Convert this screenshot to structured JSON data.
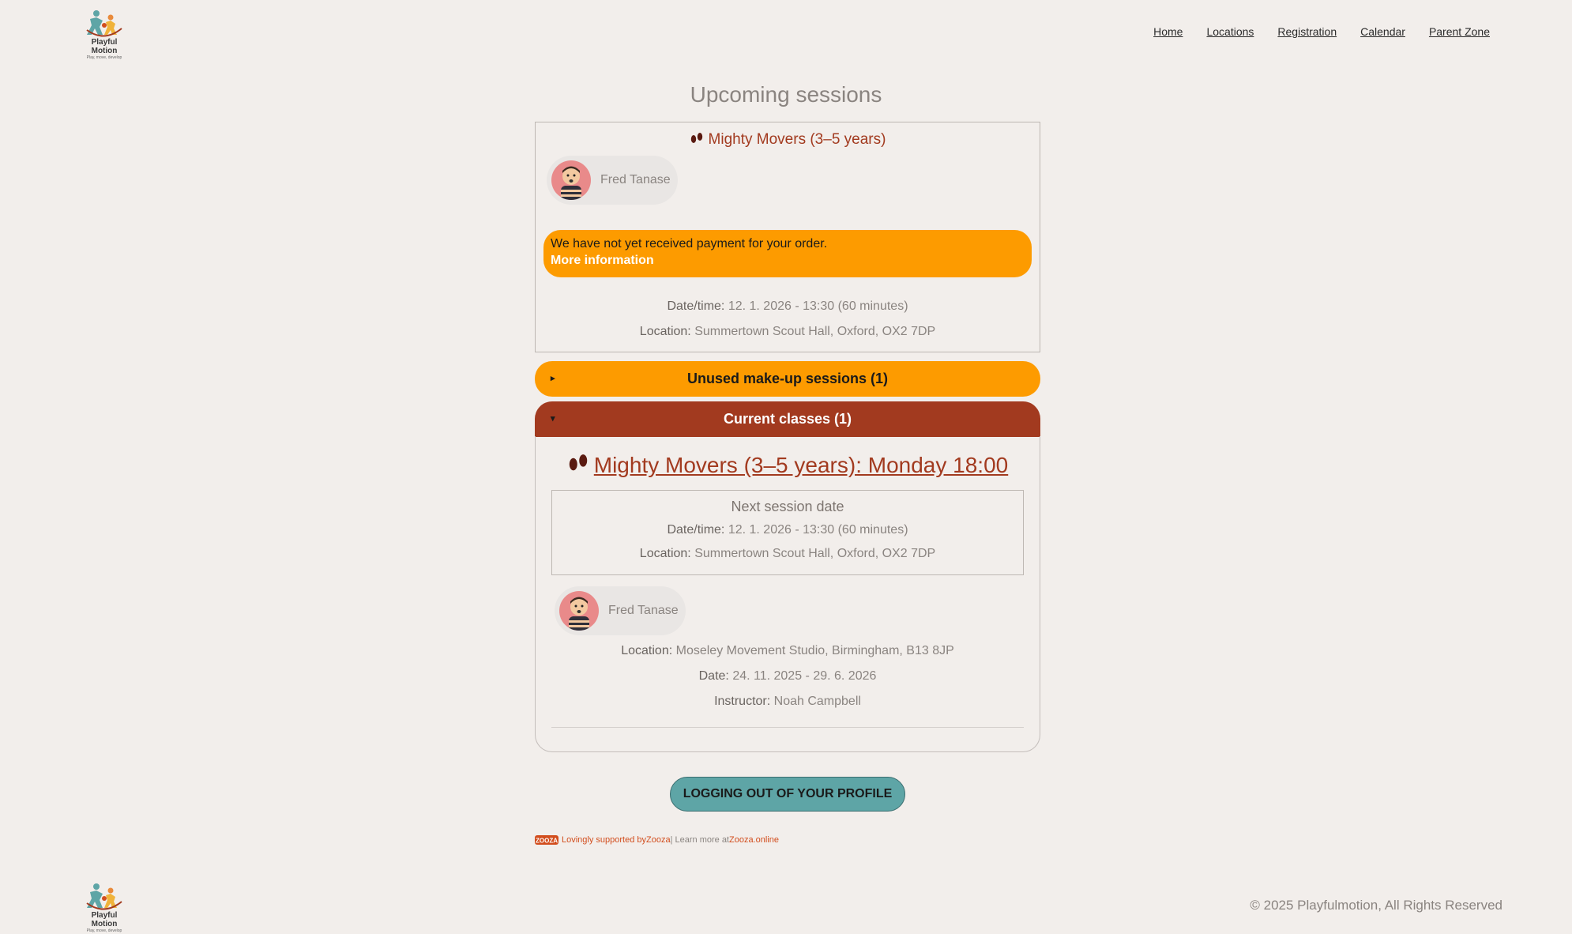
{
  "brand": {
    "name": "Playful Motion",
    "tagline": "Play, move, develop"
  },
  "nav": {
    "items": [
      "Home",
      "Locations",
      "Registration",
      "Calendar",
      "Parent Zone"
    ]
  },
  "page_title": "Upcoming sessions",
  "session": {
    "title": "Mighty Movers (3–5 years)",
    "child_name": "Fred Tanase",
    "alert": {
      "message": "We have not yet received payment for your order.",
      "link": "More information"
    },
    "datetime_label": "Date/time:",
    "datetime_value": "12. 1. 2026 - 13:30 (60 minutes)",
    "location_label": "Location:",
    "location_value": "Summertown Scout Hall, Oxford, OX2 7DP"
  },
  "accordions": {
    "makeup": {
      "label": "Unused make-up sessions (1)",
      "arrow": "▸"
    },
    "current": {
      "label": "Current classes (1)",
      "arrow": "▾"
    }
  },
  "current_class": {
    "title": "Mighty Movers (3–5 years): Monday 18:00",
    "next_session_heading": "Next session date",
    "next_datetime_label": "Date/time:",
    "next_datetime_value": "12. 1. 2026 - 13:30 (60 minutes)",
    "next_location_label": "Location:",
    "next_location_value": "Summertown Scout Hall, Oxford, OX2 7DP",
    "child_name": "Fred Tanase",
    "location_label": "Location:",
    "location_value": "Moseley Movement Studio, Birmingham, B13 8JP",
    "date_label": "Date:",
    "date_value": "24. 11. 2025 - 29. 6. 2026",
    "instructor_label": "Instructor:",
    "instructor_value": "Noah Campbell"
  },
  "logout_label": "LOGGING OUT OF YOUR PROFILE",
  "powered": {
    "lead": "Lovingly supported by ",
    "brand": "Zooza",
    "mid": " | Learn more at ",
    "site": "Zooza.online",
    "logo_text": "ZOOZA"
  },
  "copyright": "© 2025 Playfulmotion, All Rights Reserved",
  "colors": {
    "accent": "#a23a1f",
    "warning": "#fd9b00",
    "teal": "#5ea5a6",
    "background": "#f2eeeb"
  }
}
